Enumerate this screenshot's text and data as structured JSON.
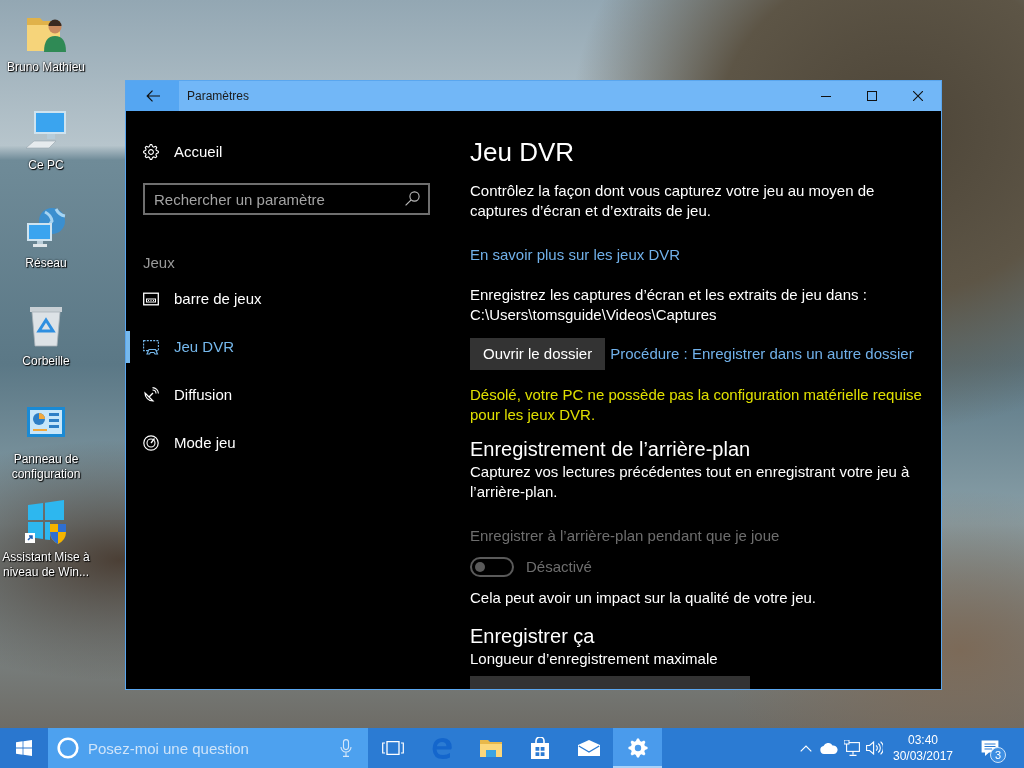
{
  "desktop": {
    "icons": [
      {
        "kind": "user-folder",
        "label": "Bruno Mathieu"
      },
      {
        "kind": "computer",
        "label": "Ce PC"
      },
      {
        "kind": "network",
        "label": "Réseau"
      },
      {
        "kind": "recycle-bin",
        "label": "Corbeille"
      },
      {
        "kind": "control-panel",
        "label": "Panneau de configuration"
      },
      {
        "kind": "installer",
        "label": "Assistant Mise à niveau de Win..."
      }
    ]
  },
  "window": {
    "title": "Paramètres"
  },
  "sidebar": {
    "home": "Accueil",
    "search": {
      "placeholder": "Rechercher un paramètre"
    },
    "section": "Jeux",
    "items": [
      {
        "kind": "game-bar",
        "label": "barre de jeux",
        "selected": false
      },
      {
        "kind": "dvr",
        "label": "Jeu DVR",
        "selected": true
      },
      {
        "kind": "broadcast",
        "label": "Diffusion",
        "selected": false
      },
      {
        "kind": "game-mode",
        "label": "Mode jeu",
        "selected": false
      }
    ]
  },
  "content": {
    "title": "Jeu DVR",
    "blocks": [
      {
        "kind": "text",
        "text": "Contrôlez la façon dont vous capturez votre jeu au moyen de captures d’écran et d’extraits de jeu."
      },
      {
        "kind": "link",
        "text": "En savoir plus sur les jeux DVR"
      },
      {
        "kind": "text",
        "text": "Enregistrez les captures d’écran et les extraits de jeu dans : C:\\Users\\tomsguide\\Videos\\Captures"
      },
      {
        "kind": "button_row",
        "button": "Ouvrir le dossier",
        "link": "Procédure : Enregistrer dans un autre dossier"
      },
      {
        "kind": "warning",
        "text": "Désolé, votre PC ne possède pas la configuration matérielle requise pour les jeux DVR."
      },
      {
        "kind": "heading",
        "text": "Enregistrement de l’arrière-plan"
      },
      {
        "kind": "text",
        "text": "Capturez vos lectures précédentes tout en enregistrant votre jeu à l’arrière-plan."
      },
      {
        "kind": "toggle",
        "label": "Enregistrer à l’arrière-plan pendant que je joue",
        "on": false,
        "disabled": true,
        "state_label": "Désactivé"
      },
      {
        "kind": "text",
        "text": "Cela peut avoir un impact sur la qualité de votre jeu."
      },
      {
        "kind": "heading",
        "text": "Enregistrer ça"
      },
      {
        "kind": "text",
        "text": "Longueur d’enregistrement maximale"
      },
      {
        "kind": "dropdown"
      }
    ]
  },
  "taskbar": {
    "search": {
      "placeholder": "Posez-moi une question"
    },
    "apps": [
      {
        "kind": "task-view",
        "selected": false
      },
      {
        "kind": "browser",
        "selected": false
      },
      {
        "kind": "file-explorer",
        "selected": false
      },
      {
        "kind": "store",
        "selected": false
      },
      {
        "kind": "mail",
        "selected": false
      },
      {
        "kind": "settings",
        "selected": true
      }
    ],
    "time": "03:40",
    "date": "30/03/2017",
    "notification_count": "3"
  }
}
